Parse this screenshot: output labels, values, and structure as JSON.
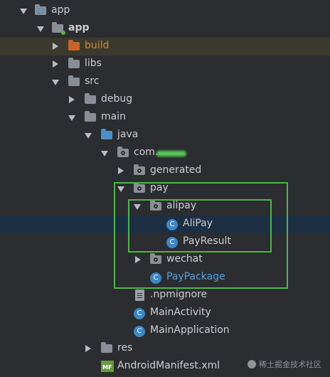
{
  "tree": {
    "app_top": "app",
    "app_module": "app",
    "build": "build",
    "libs": "libs",
    "src": "src",
    "debug": "debug",
    "main": "main",
    "java": "java",
    "package_prefix": "com.",
    "generated": "generated",
    "pay": "pay",
    "alipay": "alipay",
    "alipay_class": "AliPay",
    "payresult_class": "PayResult",
    "wechat": "wechat",
    "paypackage_class": "PayPackage",
    "npmignore": ".npmignore",
    "mainactivity_class": "MainActivity",
    "mainapplication_class": "MainApplication",
    "res": "res",
    "manifest": "AndroidManifest.xml"
  },
  "icons": {
    "class_letter": "C",
    "manifest_letters": "MF"
  },
  "watermark": "稀土掘金技术社区",
  "colors": {
    "highlight_box": "#4fb54a",
    "build_text": "#d6883a",
    "class_icon": "#3e86c6",
    "selected_row": "#1d2f42"
  }
}
